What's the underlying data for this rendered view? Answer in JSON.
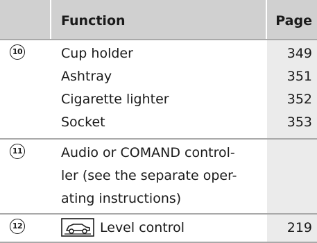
{
  "header": {
    "function_label": "Function",
    "page_label": "Page"
  },
  "rows": [
    {
      "number": "10",
      "items": [
        {
          "function": "Cup holder",
          "page": "349"
        },
        {
          "function": "Ashtray",
          "page": "351"
        },
        {
          "function": "Cigarette lighter",
          "page": "352"
        },
        {
          "function": "Socket",
          "page": "353"
        }
      ]
    },
    {
      "number": "11",
      "items": [
        {
          "function_lines": [
            "Audio or COMAND control-",
            "ler (see the separate oper-",
            "ating instructions)"
          ],
          "page": ""
        }
      ]
    },
    {
      "number": "12",
      "items": [
        {
          "icon": "level-control-icon",
          "function": "Level control",
          "page": "219"
        }
      ]
    }
  ],
  "colors": {
    "header_bg": "#d0d0d0",
    "page_column_bg": "#ebebeb",
    "row_divider": "#a9a9a9",
    "text": "#1a1a1a"
  }
}
